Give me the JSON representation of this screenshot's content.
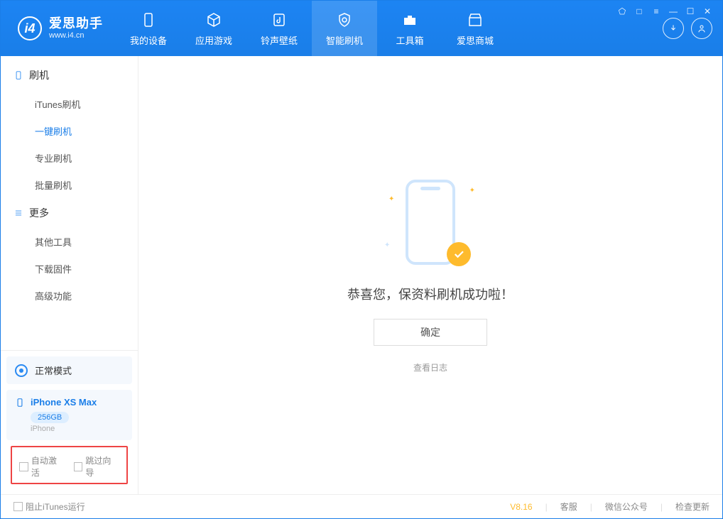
{
  "app": {
    "title": "爱思助手",
    "subdomain": "www.i4.cn"
  },
  "nav": {
    "items": [
      {
        "label": "我的设备"
      },
      {
        "label": "应用游戏"
      },
      {
        "label": "铃声壁纸"
      },
      {
        "label": "智能刷机"
      },
      {
        "label": "工具箱"
      },
      {
        "label": "爱思商城"
      }
    ]
  },
  "sidebar": {
    "group1_title": "刷机",
    "group1_items": [
      {
        "label": "iTunes刷机"
      },
      {
        "label": "一键刷机"
      },
      {
        "label": "专业刷机"
      },
      {
        "label": "批量刷机"
      }
    ],
    "group2_title": "更多",
    "group2_items": [
      {
        "label": "其他工具"
      },
      {
        "label": "下载固件"
      },
      {
        "label": "高级功能"
      }
    ]
  },
  "mode": {
    "label": "正常模式"
  },
  "device": {
    "name": "iPhone XS Max",
    "storage": "256GB",
    "type": "iPhone"
  },
  "options": {
    "auto_activate": "自动激活",
    "skip_guide": "跳过向导"
  },
  "main": {
    "success_msg": "恭喜您，保资料刷机成功啦！",
    "ok_button": "确定",
    "view_log": "查看日志"
  },
  "footer": {
    "block_itunes": "阻止iTunes运行",
    "version": "V8.16",
    "support": "客服",
    "wechat": "微信公众号",
    "check_update": "检查更新"
  }
}
